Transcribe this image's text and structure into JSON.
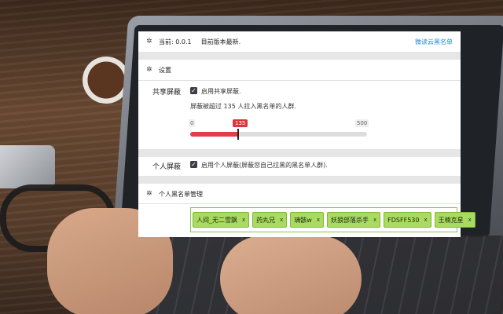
{
  "header": {
    "version_label": "当前: 0.0.1",
    "status": "目前版本最新.",
    "link": "微读云黑名单"
  },
  "settings": {
    "title": "设置"
  },
  "shared_block": {
    "label": "共享屏蔽",
    "checkbox_label": "启用共享屏蔽.",
    "description": "屏蔽被超过 135 人拉入黑名单的人群.",
    "slider": {
      "min": "0",
      "max": "500",
      "value": "135",
      "fraction": 0.27
    }
  },
  "personal_block": {
    "label": "个人屏蔽",
    "checkbox_label": "启用个人屏蔽(屏蔽您自己拉黑的黑名单人群)."
  },
  "personal_list": {
    "title": "个人黑名单管理",
    "remove_glyph": "x",
    "tags": [
      {
        "label": "人间_无二雪飘"
      },
      {
        "label": "药丸兄"
      },
      {
        "label": "璃骸w"
      },
      {
        "label": "妖狼部落杀手"
      },
      {
        "label": "FDSFF530"
      },
      {
        "label": "王楠克星"
      }
    ]
  },
  "colors": {
    "accent": "#1a8bd0",
    "slider_fill": "#e33d4a",
    "tag_bg": "#a8db60"
  }
}
